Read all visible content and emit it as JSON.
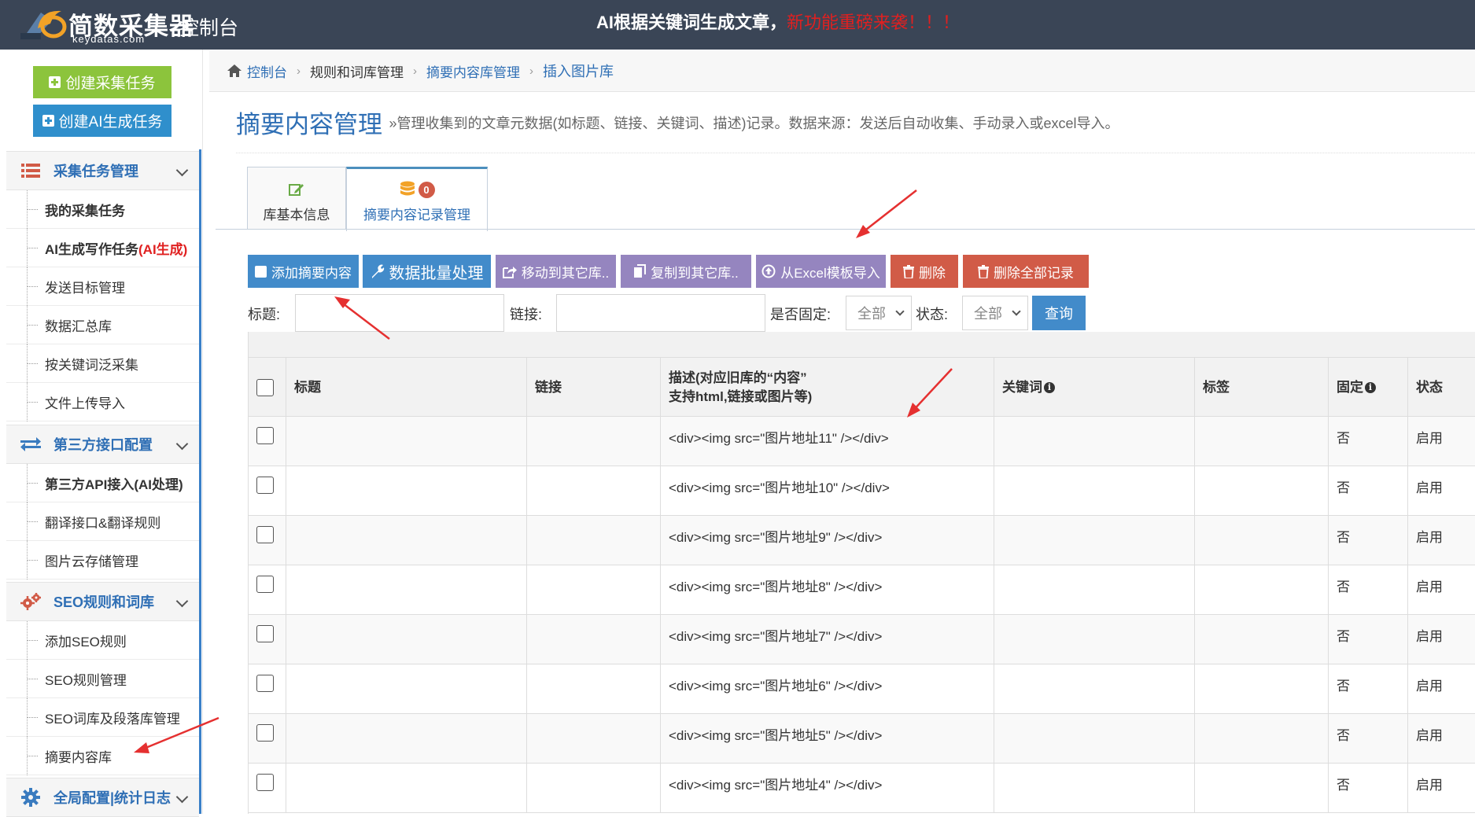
{
  "header": {
    "logo_name": "简数采集器",
    "logo_sub": "keydatas.com",
    "console_title": "控制台",
    "announce_main": "AI根据关键词生成文章，",
    "announce_red": "新功能重磅来袭！！！"
  },
  "sidebar": {
    "create_task": "创建采集任务",
    "create_ai_task": "创建AI生成任务",
    "sections": [
      {
        "label": "采集任务管理",
        "icon": "list-icon"
      },
      {
        "label": "第三方接口配置",
        "icon": "exchange-icon"
      },
      {
        "label": "SEO规则和词库",
        "icon": "cogs-icon"
      },
      {
        "label": "全局配置|统计日志",
        "icon": "gear-icon"
      }
    ],
    "items": [
      "我的采集任务",
      "AI生成写作任务",
      "(AI生成)",
      "发送目标管理",
      "数据汇总库",
      "按关键词泛采集",
      "文件上传导入",
      "第三方API接入(AI处理)",
      "翻译接口&翻译规则",
      "图片云存储管理",
      "添加SEO规则",
      "SEO规则管理",
      "SEO词库及段落库管理",
      "摘要内容库"
    ]
  },
  "breadcrumb": {
    "home": "控制台",
    "items": [
      "规则和词库管理",
      "摘要内容库管理",
      "插入图片库"
    ]
  },
  "page": {
    "title": "摘要内容管理",
    "desc": "»管理收集到的文章元数据(如标题、链接、关键词、描述)记录。数据来源：发送后自动收集、手动录入或excel导入。"
  },
  "tabs": {
    "basic": "库基本信息",
    "records": "摘要内容记录管理",
    "records_badge": "0"
  },
  "toolbar": {
    "add": "添加摘要内容",
    "batch": "数据批量处理",
    "move": "移动到其它库..",
    "copy": "复制到其它库..",
    "import": "从Excel模板导入",
    "delete": "删除",
    "delete_all": "删除全部记录"
  },
  "filters": {
    "title_label": "标题:",
    "link_label": "链接:",
    "fixed_label": "是否固定:",
    "fixed_value": "全部",
    "status_label": "状态:",
    "status_value": "全部",
    "query": "查询"
  },
  "table": {
    "columns": {
      "title": "标题",
      "link": "链接",
      "desc_line1": "描述(对应旧库的“内容”",
      "desc_line2": "支持html,链接或图片等)",
      "keywords": "关键词",
      "tags": "标签",
      "fixed": "固定",
      "status": "状态"
    },
    "rows": [
      {
        "title": "",
        "link": "",
        "desc": "<div><img src=\"图片地址11\" /></div>",
        "keywords": "",
        "tags": "",
        "fixed": "否",
        "status": "启用"
      },
      {
        "title": "",
        "link": "",
        "desc": "<div><img src=\"图片地址10\" /></div>",
        "keywords": "",
        "tags": "",
        "fixed": "否",
        "status": "启用"
      },
      {
        "title": "",
        "link": "",
        "desc": "<div><img src=\"图片地址9\" /></div>",
        "keywords": "",
        "tags": "",
        "fixed": "否",
        "status": "启用"
      },
      {
        "title": "",
        "link": "",
        "desc": "<div><img src=\"图片地址8\" /></div>",
        "keywords": "",
        "tags": "",
        "fixed": "否",
        "status": "启用"
      },
      {
        "title": "",
        "link": "",
        "desc": "<div><img src=\"图片地址7\" /></div>",
        "keywords": "",
        "tags": "",
        "fixed": "否",
        "status": "启用"
      },
      {
        "title": "",
        "link": "",
        "desc": "<div><img src=\"图片地址6\" /></div>",
        "keywords": "",
        "tags": "",
        "fixed": "否",
        "status": "启用"
      },
      {
        "title": "",
        "link": "",
        "desc": "<div><img src=\"图片地址5\" /></div>",
        "keywords": "",
        "tags": "",
        "fixed": "否",
        "status": "启用"
      },
      {
        "title": "",
        "link": "",
        "desc": "<div><img src=\"图片地址4\" /></div>",
        "keywords": "",
        "tags": "",
        "fixed": "否",
        "status": "启用"
      }
    ]
  },
  "colors": {
    "header_bg": "#3a4556",
    "link_blue": "#2f6fb5",
    "btn_blue": "#428bca",
    "btn_purple": "#9585bf",
    "btn_red": "#d15b47",
    "btn_green": "#8cc43c",
    "annotation_arrow": "#e53030"
  }
}
